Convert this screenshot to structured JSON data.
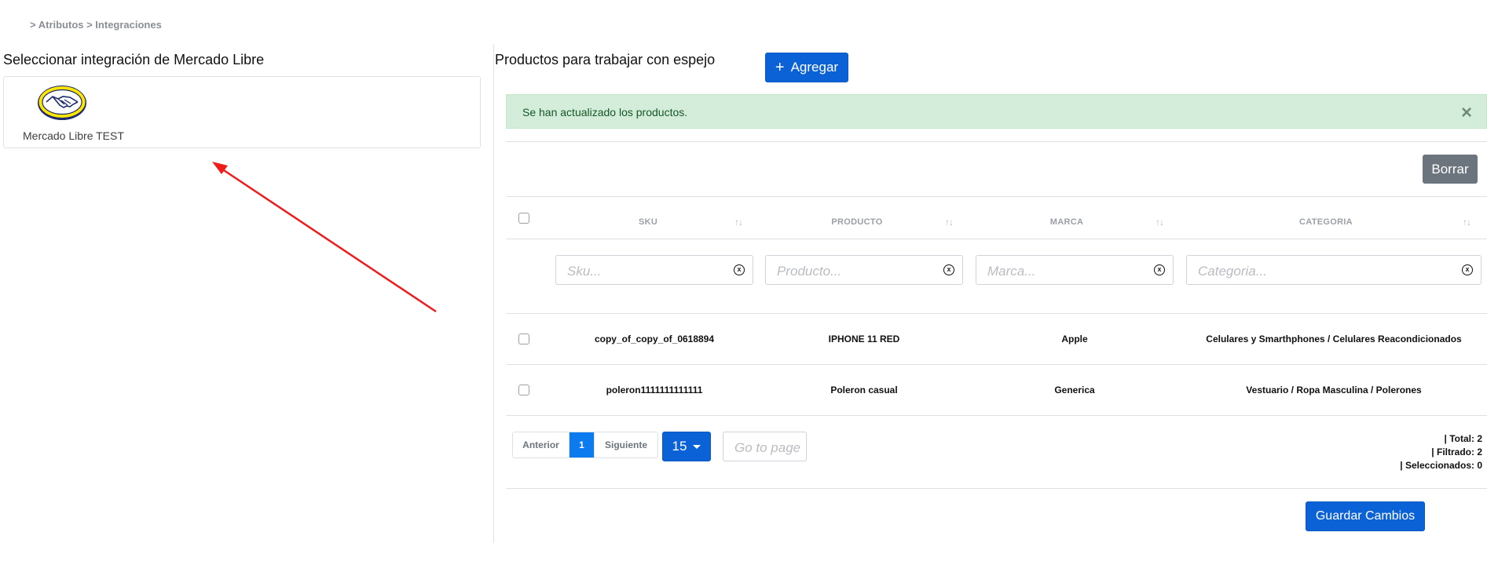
{
  "breadcrumb": "> Atributos > Integraciones",
  "left_panel": {
    "title": "Seleccionar integración de Mercado Libre",
    "integrations": [
      {
        "name": "Mercado Libre TEST",
        "logo": "mercado-libre-handshake-logo"
      }
    ]
  },
  "right_panel": {
    "title": "Productos para trabajar con espejo",
    "add_button": {
      "icon": "plus-icon",
      "label": "Agregar"
    },
    "alert": {
      "message": "Se han actualizado los productos.",
      "close_symbol": "×"
    },
    "delete_button": "Borrar",
    "table": {
      "columns": [
        {
          "key": "sku",
          "label": "SKU",
          "filter_placeholder": "Sku..."
        },
        {
          "key": "producto",
          "label": "PRODUCTO",
          "filter_placeholder": "Producto..."
        },
        {
          "key": "marca",
          "label": "MARCA",
          "filter_placeholder": "Marca..."
        },
        {
          "key": "categoria",
          "label": "CATEGORIA",
          "filter_placeholder": "Categoria..."
        }
      ],
      "sort_icon": "↑↓",
      "clear_symbol": "x",
      "rows": [
        {
          "sku": "copy_of_copy_of_0618894",
          "producto": "IPHONE 11 RED",
          "marca": "Apple",
          "categoria": "Celulares y Smarthphones / Celulares Reacondicionados"
        },
        {
          "sku": "poleron1111111111111",
          "producto": "Poleron casual",
          "marca": "Generica",
          "categoria": "Vestuario / Ropa Masculina / Polerones"
        }
      ]
    },
    "pagination": {
      "prev_label": "Anterior",
      "current_page": "1",
      "next_label": "Siguiente",
      "page_size": "15",
      "goto_placeholder": "Go to page"
    },
    "stats": {
      "total": "| Total: 2",
      "filtered": "| Filtrado: 2",
      "selected": "| Seleccionados: 0"
    },
    "save_button": "Guardar Cambios"
  },
  "colors": {
    "primary": "#0b62d6",
    "success_bg": "#d4edda",
    "secondary": "#6c757d",
    "annotation_arrow": "#ee1c1c"
  }
}
